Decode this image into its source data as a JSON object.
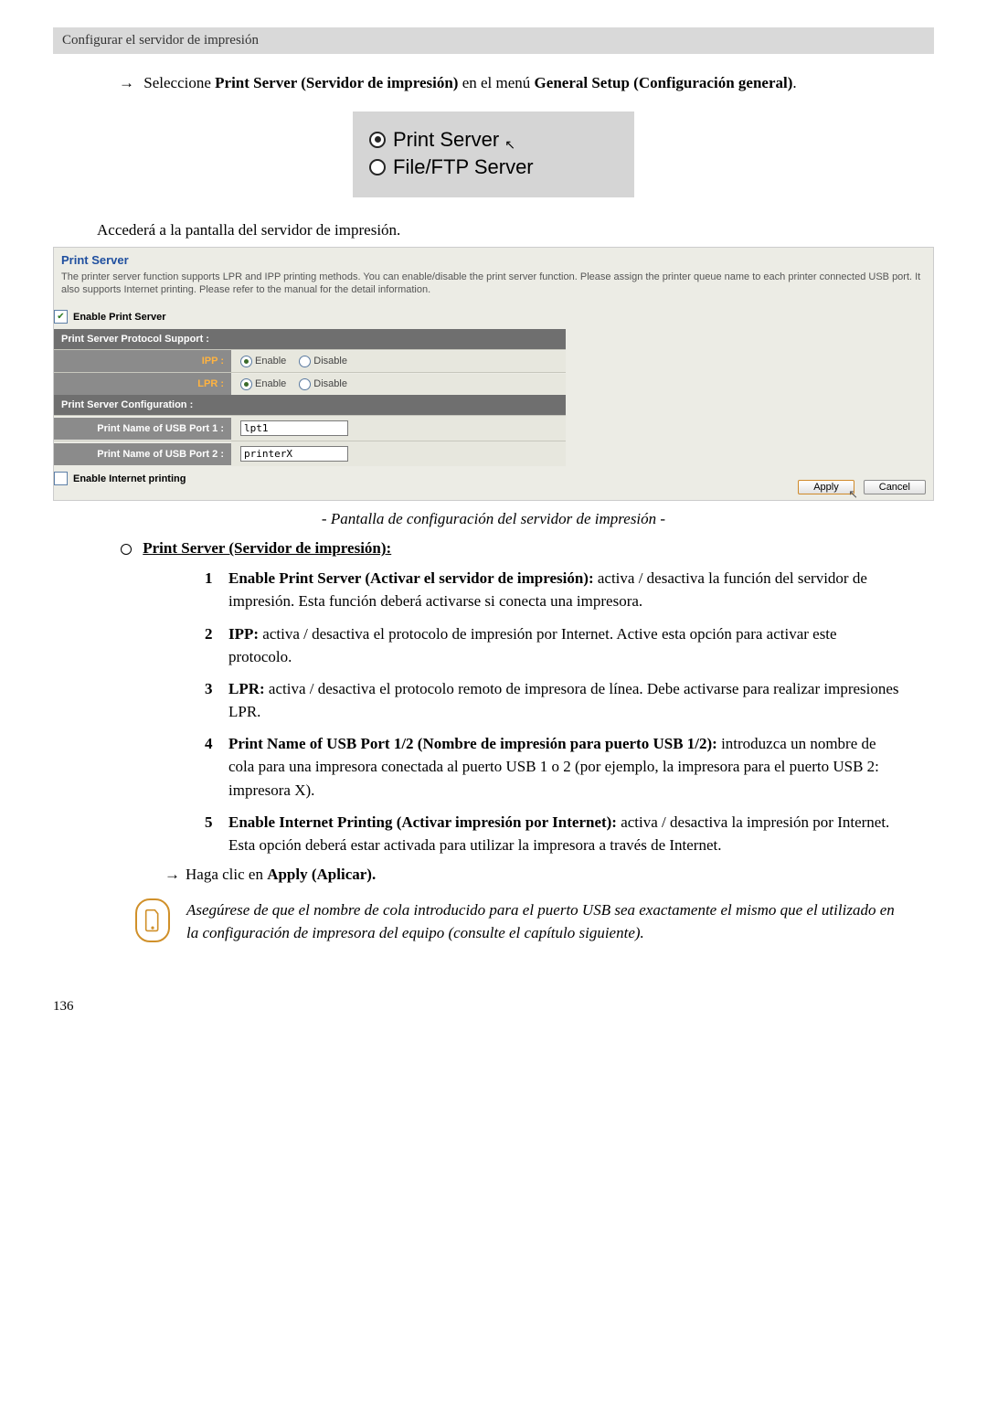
{
  "topbar": "Configurar el servidor de impresión",
  "step1": {
    "prefix": "Seleccione ",
    "bold1": "Print Server (Servidor de impresión)",
    "mid": " en el menú ",
    "bold2": "General Setup (Configuración general)",
    "suffix": "."
  },
  "radioBox": {
    "option1": "Print Server",
    "option2": "File/FTP Server"
  },
  "accessText": "Accederá a la pantalla del servidor de impresión.",
  "panel": {
    "title": "Print Server",
    "desc": "The printer server function supports LPR and IPP printing methods. You can enable/disable the print server function. Please assign the printer queue name to each printer connected USB port. It also supports Internet printing. Please refer to the manual for the detail information.",
    "enablePrintServer": "Enable Print Server",
    "protoSupport": "Print Server Protocol Support :",
    "ipp": "IPP :",
    "lpr": "LPR :",
    "enable": "Enable",
    "disable": "Disable",
    "configHdr": "Print Server Configuration :",
    "usb1Label": "Print Name of USB Port 1 :",
    "usb1Value": "lpt1",
    "usb2Label": "Print Name of USB Port 2 :",
    "usb2Value": "printerX",
    "enableInternet": "Enable Internet printing",
    "apply": "Apply",
    "cancel": "Cancel"
  },
  "caption": "- Pantalla de configuración del servidor de impresión -",
  "sectionHeader": "Print Server (Servidor de impresión):",
  "items": [
    {
      "n": "1",
      "bold": "Enable Print Server (Activar el servidor de impresión):",
      "text": " activa / desactiva la función del servidor de impresión. Esta función deberá activarse si conecta una impresora."
    },
    {
      "n": "2",
      "bold": "IPP:",
      "text": " activa / desactiva el protocolo de impresión por Internet. Active esta opción para activar este protocolo."
    },
    {
      "n": "3",
      "bold": "LPR:",
      "text": " activa / desactiva el protocolo remoto de impresora de línea. Debe activarse para realizar impresiones LPR."
    },
    {
      "n": "4",
      "bold": "Print Name of USB Port 1/2 (Nombre de impresión para puerto USB 1/2):",
      "text": " introduzca un nombre de cola para una impresora conectada al puerto USB 1 o 2 (por ejemplo, la impresora para el puerto USB 2: impresora X)."
    },
    {
      "n": "5",
      "bold": "Enable Internet Printing (Activar impresión por Internet):",
      "text": " activa / desactiva la impresión por Internet. Esta opción deberá estar activada para utilizar la impresora a través de Internet."
    }
  ],
  "clickApply": {
    "prefix": "Haga clic en ",
    "bold": "Apply (Aplicar)."
  },
  "note": "Asegúrese de que el nombre de cola introducido para el puerto USB sea exactamente el mismo que el utilizado en la configuración de impresora del equipo (consulte el capítulo siguiente).",
  "pageNumber": "136"
}
